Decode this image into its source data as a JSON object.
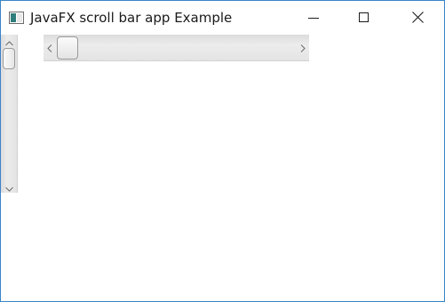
{
  "window": {
    "title": "JavaFX scroll bar app Example",
    "app_icon": "java-app-icon",
    "controls": {
      "minimize_icon": "minimize-icon",
      "maximize_icon": "maximize-icon",
      "close_icon": "close-icon"
    },
    "accent_border_color": "#3a84c9"
  },
  "vertical_scrollbar": {
    "orientation": "vertical",
    "value": 0,
    "up_icon": "chevron-up-icon",
    "down_icon": "chevron-down-icon"
  },
  "horizontal_scrollbar": {
    "orientation": "horizontal",
    "value": 0,
    "left_icon": "chevron-left-icon",
    "right_icon": "chevron-right-icon"
  }
}
